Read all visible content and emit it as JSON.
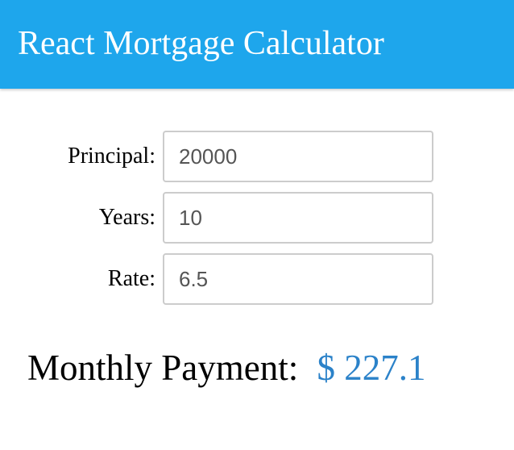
{
  "header": {
    "title": "React Mortgage Calculator"
  },
  "form": {
    "principal": {
      "label": "Principal:",
      "value": "20000"
    },
    "years": {
      "label": "Years:",
      "value": "10"
    },
    "rate": {
      "label": "Rate:",
      "value": "6.5"
    }
  },
  "result": {
    "label": "Monthly Payment:",
    "value": "$ 227.1"
  },
  "colors": {
    "header_background": "#1ea6ec",
    "result_value": "#2b82c9"
  }
}
